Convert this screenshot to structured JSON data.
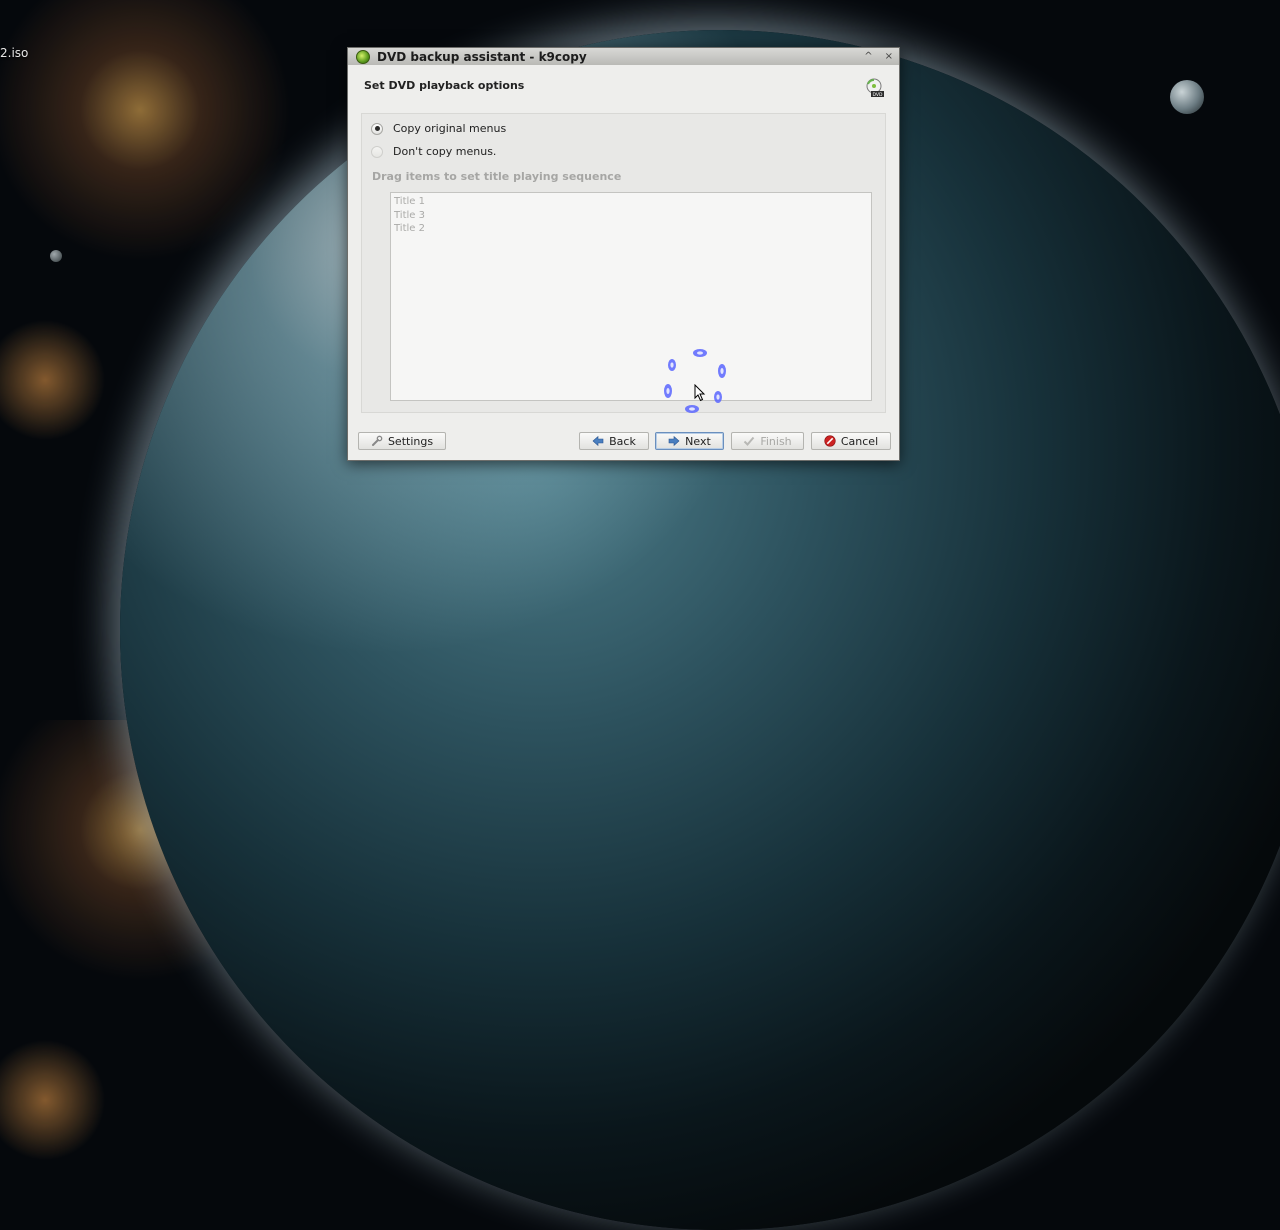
{
  "desktop": {
    "file_label": "2.iso"
  },
  "window": {
    "title": "DVD backup assistant - k9copy",
    "controls": {
      "minimize": "^",
      "close": "×"
    }
  },
  "page": {
    "header_title": "Set DVD playback options",
    "options": [
      {
        "label": "Copy original menus",
        "checked": true
      },
      {
        "label": "Don't copy menus.",
        "checked": false
      }
    ],
    "sequence_label": "Drag items to set title playing sequence",
    "titles": [
      "Title 1",
      "Title 3",
      "Title 2"
    ]
  },
  "buttons": {
    "settings": "Settings",
    "back": "Back",
    "next": "Next",
    "finish": "Finish",
    "cancel": "Cancel"
  },
  "colors": {
    "accent": "#6a8fbd",
    "cancel_icon": "#cc2222",
    "busy_indicator": "#5a66ff"
  },
  "icons": {
    "app": "k9copy-app-icon",
    "header": "dvd-icon",
    "settings": "wrench-icon",
    "back": "arrow-left-icon",
    "next": "arrow-right-icon",
    "finish": "checkmark-icon",
    "cancel": "cancel-icon"
  }
}
